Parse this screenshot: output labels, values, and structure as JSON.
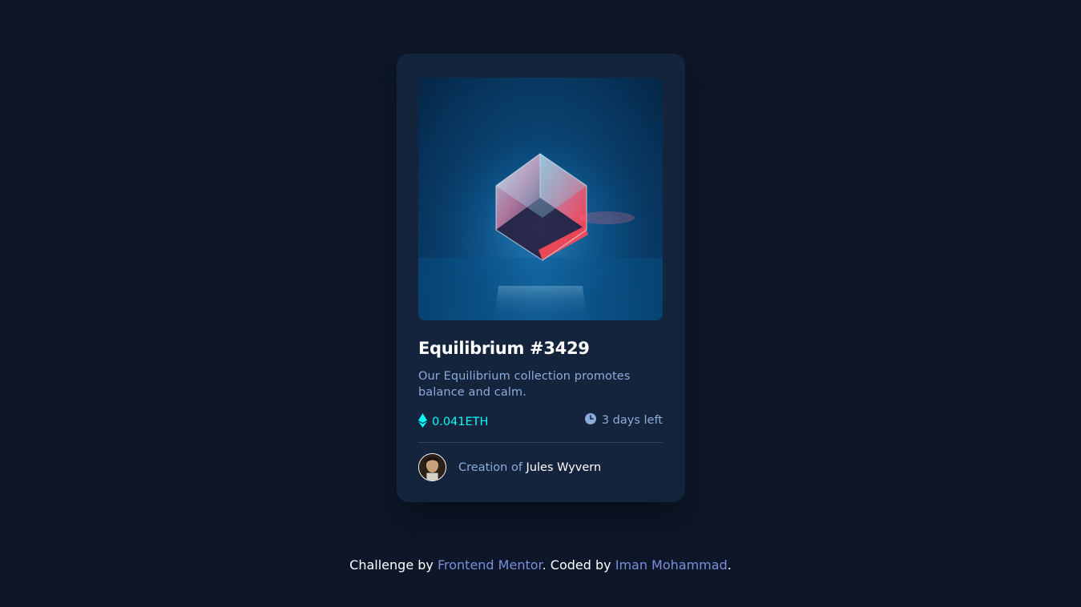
{
  "card": {
    "title": "Equilibrium #3429",
    "description": "Our Equilibrium collection promotes balance and calm.",
    "price": "0.041ETH",
    "time_left": "3 days left",
    "creator_prefix": "Creation of",
    "creator_name": "Jules Wyvern"
  },
  "icons": {
    "price": "ethereum-icon",
    "time": "clock-icon"
  },
  "footer": {
    "prefix": "Challenge by",
    "link1": "Frontend Mentor",
    "middle": ". Coded by",
    "link2": "Iman Mohammad",
    "suffix": "."
  },
  "colors": {
    "background": "#0d1729",
    "card": "#15243d",
    "accent": "#00fff8",
    "muted": "#8bacd9",
    "link": "#7b8fd9"
  }
}
